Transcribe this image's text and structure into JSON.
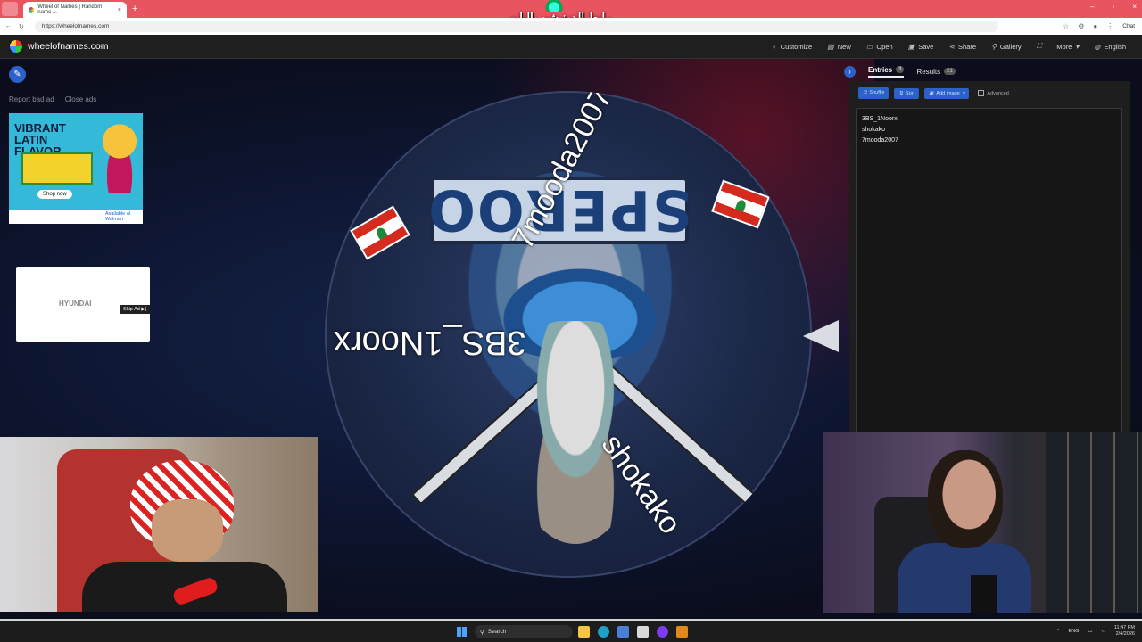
{
  "browser": {
    "tab_title": "Wheel of Names | Random name ...",
    "tab_close": "×",
    "new_tab": "+",
    "url": "https://wheelofnames.com",
    "overlay_text": "رابط الدونيشن بالبايو",
    "chat_label": "Chat",
    "window_controls": [
      "–",
      "▫",
      "×"
    ]
  },
  "site": {
    "name": "wheelofnames.com",
    "nav": [
      {
        "label": "Customize",
        "icon": "palette-icon",
        "glyph": "◐"
      },
      {
        "label": "New",
        "icon": "file-icon",
        "glyph": "▤"
      },
      {
        "label": "Open",
        "icon": "folder-icon",
        "glyph": "▭"
      },
      {
        "label": "Save",
        "icon": "save-icon",
        "glyph": "▣"
      },
      {
        "label": "Share",
        "icon": "share-icon",
        "glyph": "⋖"
      },
      {
        "label": "Gallery",
        "icon": "search-icon",
        "glyph": "⚲"
      },
      {
        "label": "",
        "icon": "fullscreen-icon",
        "glyph": "⛶"
      },
      {
        "label": "More",
        "icon": "chevron-down-icon",
        "glyph": "▾"
      },
      {
        "label": "English",
        "icon": "globe-icon",
        "glyph": "◍"
      }
    ]
  },
  "ads": {
    "report": "Report bad ad",
    "close": "Close ads",
    "ad1_headline": "VIBRANT LATIN FLAVOR",
    "ad1_button": "Shop now",
    "ad1_retailer": "Available at Walmart",
    "ad2_brand": "HYUNDAI",
    "ad2_skip": "Skip Ad ▶|"
  },
  "wheel": {
    "banner_text": "SPEROO"
  },
  "panel": {
    "tabs": [
      {
        "label": "Entries",
        "count": "3"
      },
      {
        "label": "Results",
        "count": "21"
      }
    ],
    "buttons": {
      "shuffle": "Shuffle",
      "sort": "Sort",
      "add_image": "Add image",
      "advanced": "Advanced"
    },
    "entries": [
      "3BS_1Noorx",
      "shokako",
      "7mooda2007"
    ]
  },
  "taskbar": {
    "search": "Search",
    "lang": "ENG",
    "time": "11:47 PM",
    "date": "2/4/2026"
  }
}
